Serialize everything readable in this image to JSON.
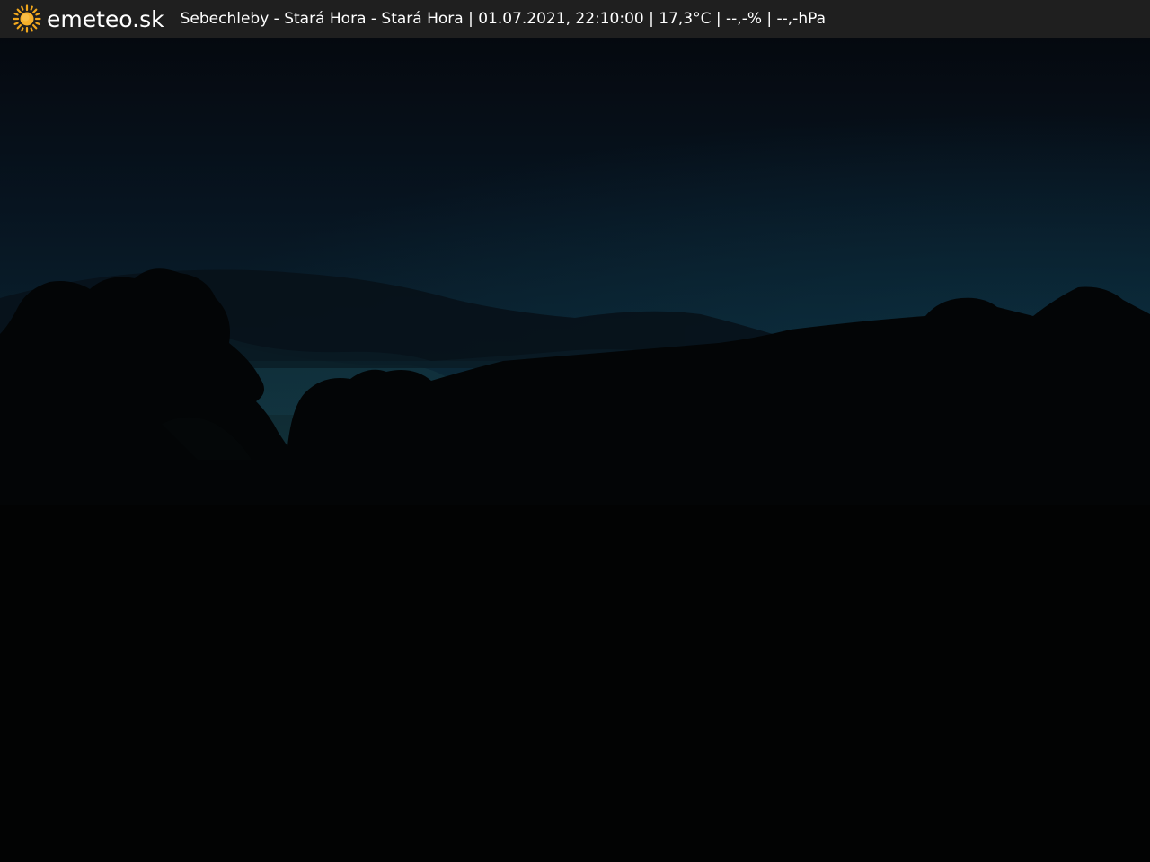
{
  "header": {
    "brand": "emeteo.sk",
    "logo_icon": "sun-icon",
    "caption": "Sebechleby - Stará Hora - Stará Hora | 01.07.2021, 22:10:00 | 17,3°C | --,-% | --,-hPa"
  },
  "colors": {
    "bar_background": "#1f1f1f",
    "sun": "#f2a81d",
    "sky_top": "#060b12",
    "sky_horizon": "#0a2230",
    "ground": "#020303"
  }
}
